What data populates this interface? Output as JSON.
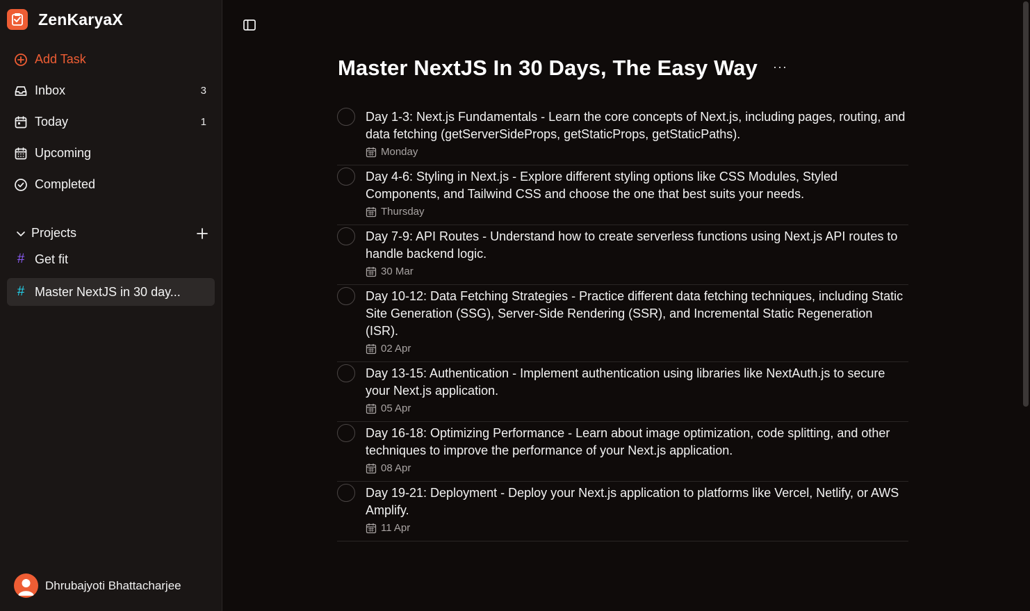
{
  "brand": {
    "name": "ZenKaryaX",
    "accent": "#ee5d34"
  },
  "nav": [
    {
      "id": "add",
      "label": "Add Task",
      "icon": "plus-circle-icon",
      "count": ""
    },
    {
      "id": "inbox",
      "label": "Inbox",
      "icon": "inbox-icon",
      "count": "3"
    },
    {
      "id": "today",
      "label": "Today",
      "icon": "calendar-day-icon",
      "count": "1"
    },
    {
      "id": "upcoming",
      "label": "Upcoming",
      "icon": "calendar-grid-icon",
      "count": ""
    },
    {
      "id": "completed",
      "label": "Completed",
      "icon": "check-circle-icon",
      "count": ""
    }
  ],
  "projects": {
    "heading": "Projects",
    "items": [
      {
        "label": "Get fit",
        "hash_color": "#8b5cf6"
      },
      {
        "label": "Master NextJS in 30 day...",
        "hash_color": "#22d3ee",
        "active": true
      }
    ]
  },
  "user": {
    "name": "Dhrubajyoti Bhattacharjee"
  },
  "main": {
    "title": "Master NextJS In 30 Days, The Easy Way",
    "more": "···",
    "tasks": [
      {
        "text": "Day 1-3: Next.js Fundamentals - Learn the core concepts of Next.js, including pages, routing, and data fetching (getServerSideProps, getStaticProps, getStaticPaths).",
        "due": "Monday"
      },
      {
        "text": "Day 4-6: Styling in Next.js - Explore different styling options like CSS Modules, Styled Components, and Tailwind CSS and choose the one that best suits your needs.",
        "due": "Thursday"
      },
      {
        "text": "Day 7-9: API Routes - Understand how to create serverless functions using Next.js API routes to handle backend logic.",
        "due": "30 Mar"
      },
      {
        "text": "Day 10-12: Data Fetching Strategies - Practice different data fetching techniques, including Static Site Generation (SSG), Server-Side Rendering (SSR), and Incremental Static Regeneration (ISR).",
        "due": "02 Apr"
      },
      {
        "text": "Day 13-15: Authentication - Implement authentication using libraries like NextAuth.js to secure your Next.js application.",
        "due": "05 Apr"
      },
      {
        "text": "Day 16-18: Optimizing Performance - Learn about image optimization, code splitting, and other techniques to improve the performance of your Next.js application.",
        "due": "08 Apr"
      },
      {
        "text": "Day 19-21: Deployment - Deploy your Next.js application to platforms like Vercel, Netlify, or AWS Amplify.",
        "due": "11 Apr"
      }
    ]
  }
}
